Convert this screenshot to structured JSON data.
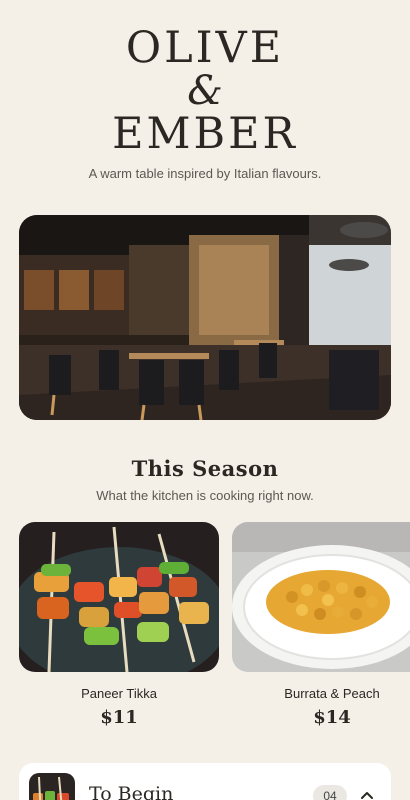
{
  "brand": {
    "line1": "OLIVE",
    "amp": "&",
    "line2": "EMBER",
    "tagline": "A warm table inspired by Italian flavours."
  },
  "hero": {
    "image": "restaurant-interior-photo"
  },
  "season": {
    "title": "This Season",
    "subtitle": "What the kitchen is cooking right now.",
    "dishes": [
      {
        "name": "Paneer Tikka",
        "price": "$11",
        "image": "paneer-tikka-skewers-photo"
      },
      {
        "name": "Burrata & Peach",
        "price": "$14",
        "image": "chickpea-bowl-photo"
      }
    ]
  },
  "menu_section": {
    "title": "To Begin",
    "count": "04",
    "icon": "chevron-up-icon"
  }
}
